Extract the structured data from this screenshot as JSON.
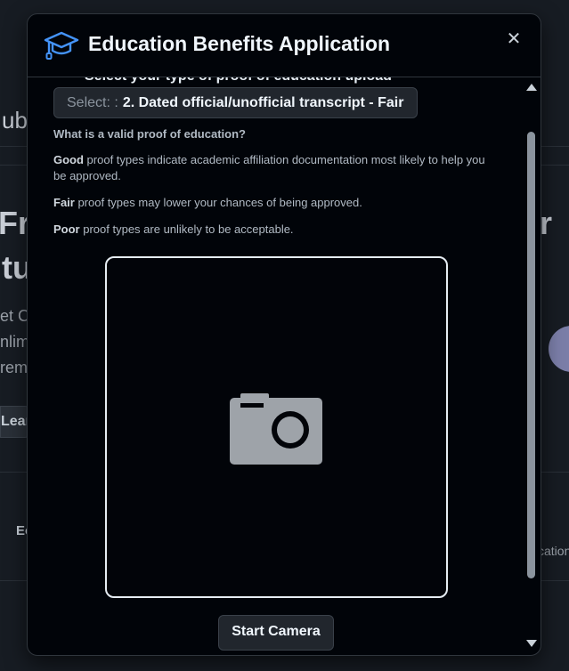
{
  "background": {
    "fragments": {
      "top_text": "ub",
      "big_line1": "Fre",
      "big_line2": "tu",
      "sub_line1": "et C",
      "sub_line2": "nlim",
      "sub_line3": "rem",
      "learn_btn": "Lear",
      "nav_item": "Ec",
      "right_big": "r",
      "right_small": "cation"
    }
  },
  "modal": {
    "title": "Education Benefits Application",
    "peek_heading": "Select your type of proof of education upload",
    "select": {
      "label": "Select: :",
      "value": "2. Dated official/unofficial transcript - Fair"
    },
    "info": {
      "question": "What is a valid proof of education?",
      "good_term": "Good",
      "good_text": " proof types indicate academic affiliation documentation most likely to help you be approved.",
      "fair_term": "Fair",
      "fair_text": " proof types may lower your chances of being approved.",
      "poor_term": "Poor",
      "poor_text": " proof types are unlikely to be acceptable."
    },
    "start_camera_label": "Start Camera",
    "close_symbol": "✕",
    "icons": {
      "header": "graduation-cap-icon",
      "camera": "camera-icon"
    },
    "colors": {
      "accent": "#4493f8",
      "camera_icon": "#9ea3a9"
    }
  }
}
